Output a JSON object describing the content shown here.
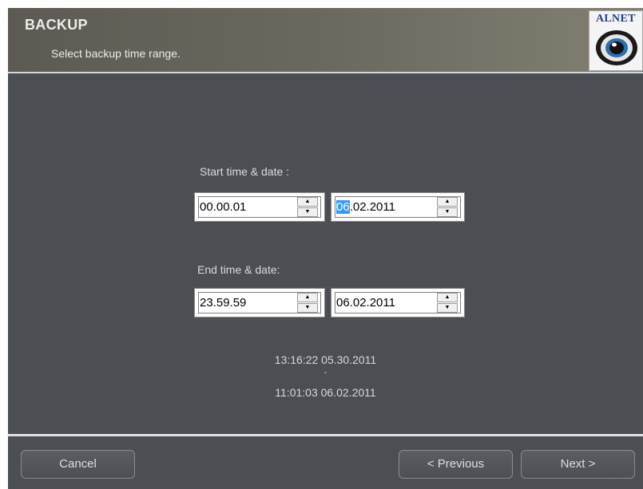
{
  "header": {
    "title": "BACKUP",
    "subtitle": "Select backup time range.",
    "logo_text": "ALNET"
  },
  "start": {
    "label": "Start time & date :",
    "time": "00.00.01",
    "date_selected": "06",
    "date_rest": ".02.2011"
  },
  "end": {
    "label": "End time & date:",
    "time": "23.59.59",
    "date": "06.02.2011"
  },
  "range": {
    "from": "13:16:22 05.30.2011",
    "separator": "-",
    "to": "11:01:03 06.02.2011"
  },
  "footer": {
    "cancel_label": "Cancel",
    "previous_label": "< Previous",
    "next_label": "Next >"
  }
}
